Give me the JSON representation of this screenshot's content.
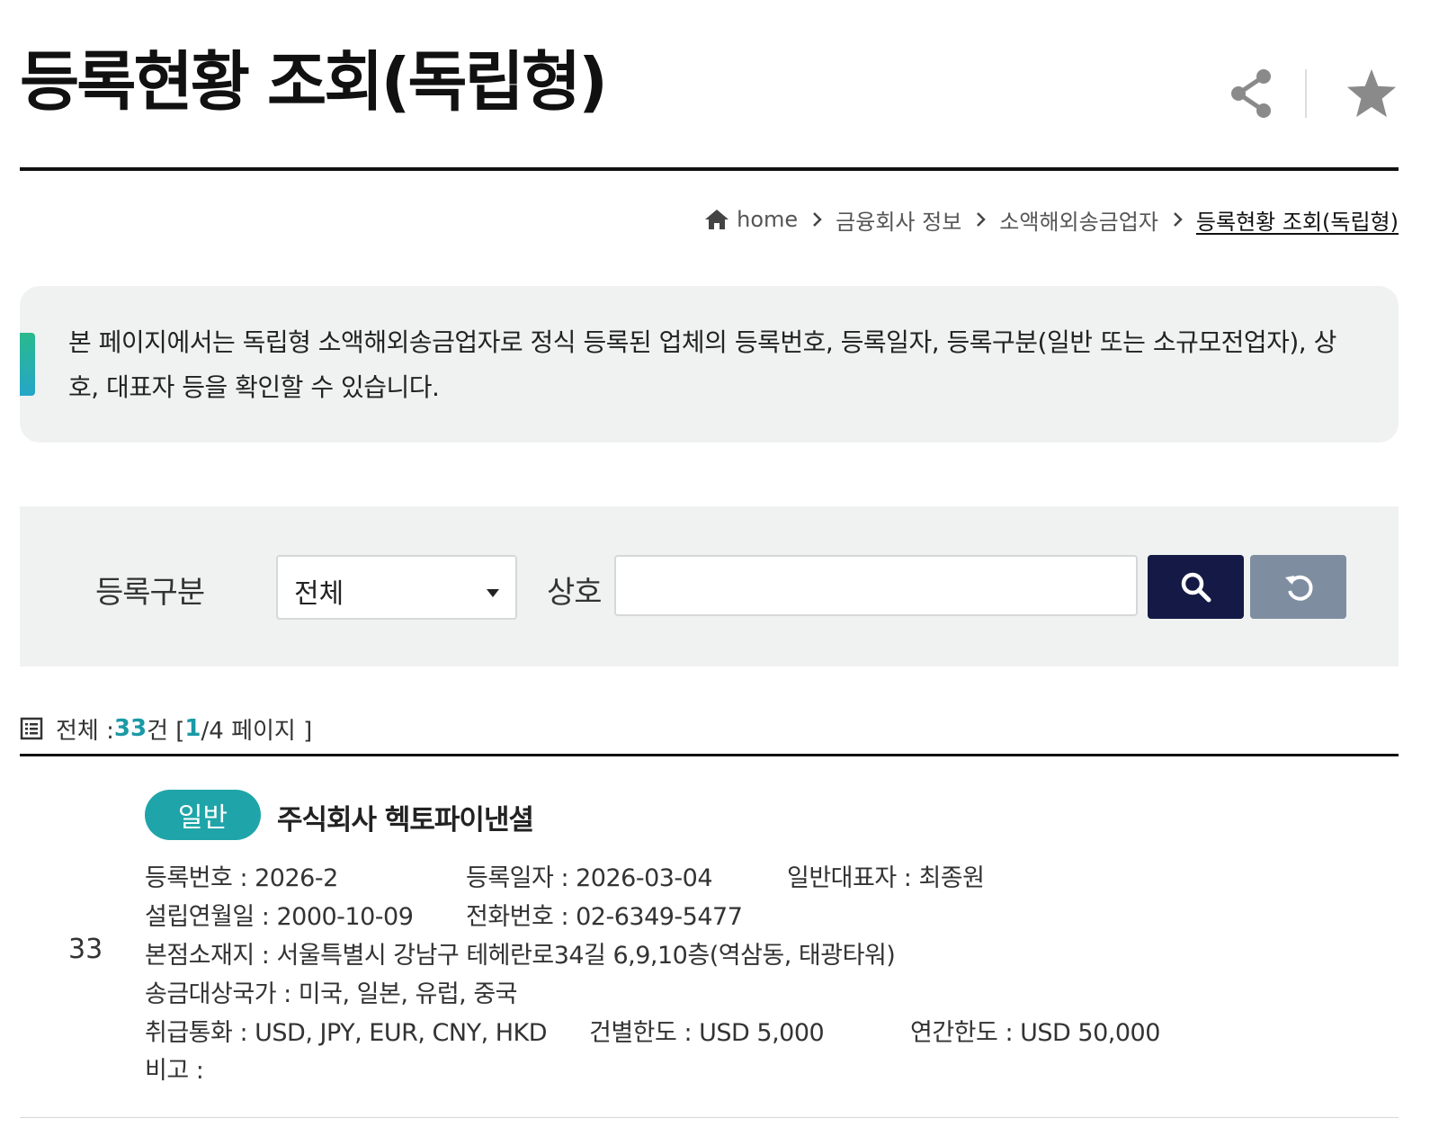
{
  "page": {
    "title": "등록현황 조회(독립형)"
  },
  "breadcrumb": {
    "home": "home",
    "items": [
      "금융회사 정보",
      "소액해외송금업자",
      "등록현황 조회(독립형)"
    ]
  },
  "info": {
    "text": "본 페이지에서는 독립형 소액해외송금업자로 정식 등록된 업체의 등록번호, 등록일자, 등록구분(일반 또는 소규모전업자), 상호, 대표자 등을 확인할 수 있습니다."
  },
  "search": {
    "category_label": "등록구분",
    "category_value": "전체",
    "name_label": "상호",
    "name_value": "",
    "search_icon": "search-icon",
    "reset_icon": "refresh-icon"
  },
  "count": {
    "prefix": "전체 :",
    "total": "33",
    "unit": "건 [",
    "page": "1",
    "page_suffix": "/4 페이지 ]"
  },
  "records": [
    {
      "no": "33",
      "badge": "일반",
      "name": "주식회사 헥토파이낸셜",
      "reg_no": "등록번호 : 2026-2",
      "reg_date": "등록일자 : 2026-03-04",
      "rep": "일반대표자 : 최종원",
      "founded": "설립연월일 : 2000-10-09",
      "phone": "전화번호 : 02-6349-5477",
      "address": "본점소재지 : 서울특별시 강남구 테헤란로34길 6,9,10층(역삼동, 태광타워)",
      "countries": "송금대상국가 : 미국, 일본, 유럽, 중국",
      "currency": "취급통화 : USD, JPY, EUR, CNY, HKD",
      "per_limit": "건별한도 : USD 5,000",
      "annual_limit": "연간한도 : USD 50,000",
      "remark": "비고 :"
    }
  ],
  "colors": {
    "accent": "#1fa5a9",
    "search_button": "#141a45",
    "reset_button": "#7f8da0",
    "panel_bg": "#f0f2f1"
  }
}
